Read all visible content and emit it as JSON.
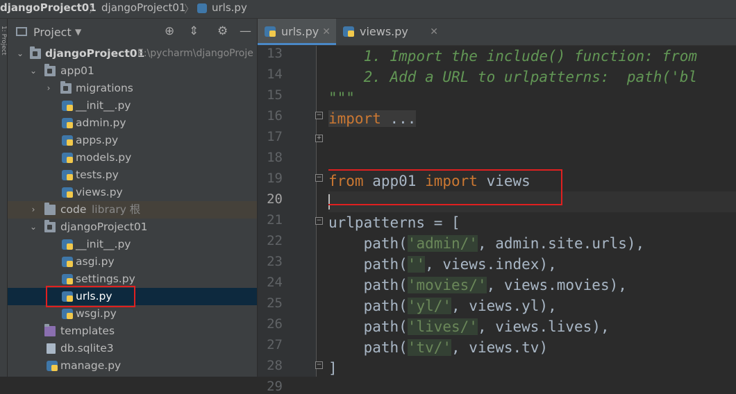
{
  "breadcrumbs": [
    "djangoProject01",
    "djangoProject01",
    "urls.py"
  ],
  "stripe_label": "1: Project",
  "project_panel": {
    "title": "Project",
    "icons": [
      "target-icon",
      "collapse-icon",
      "gear-icon",
      "minimize-icon"
    ]
  },
  "tree": [
    {
      "label": "djangoProject01",
      "extra": "E:\\pycharm\\djangoProje",
      "type": "folder-module",
      "bold": true,
      "expanded": true
    },
    {
      "label": "app01",
      "type": "folder-module",
      "expanded": true
    },
    {
      "label": "migrations",
      "type": "folder-module",
      "expanded": false
    },
    {
      "label": "__init__.py",
      "type": "py"
    },
    {
      "label": "admin.py",
      "type": "py"
    },
    {
      "label": "apps.py",
      "type": "py"
    },
    {
      "label": "models.py",
      "type": "py"
    },
    {
      "label": "tests.py",
      "type": "py"
    },
    {
      "label": "views.py",
      "type": "py"
    },
    {
      "label": "code",
      "extra": "library 根",
      "type": "folder",
      "expanded": false
    },
    {
      "label": "djangoProject01",
      "type": "folder-module",
      "expanded": true
    },
    {
      "label": "__init__.py",
      "type": "py"
    },
    {
      "label": "asgi.py",
      "type": "py"
    },
    {
      "label": "settings.py",
      "type": "py"
    },
    {
      "label": "urls.py",
      "type": "py",
      "selected": true
    },
    {
      "label": "wsgi.py",
      "type": "py"
    },
    {
      "label": "templates",
      "type": "folder"
    },
    {
      "label": "db.sqlite3",
      "type": "file"
    },
    {
      "label": "manage.py",
      "type": "py"
    }
  ],
  "tabs": [
    {
      "label": "urls.py",
      "active": true
    },
    {
      "label": "views.py",
      "active": false
    }
  ],
  "line_numbers": [
    "13",
    "14",
    "15",
    "16",
    "17",
    "18",
    "19",
    "20",
    "21",
    "22",
    "23",
    "24",
    "25",
    "26",
    "27",
    "28",
    "29"
  ],
  "current_line": "20",
  "code": {
    "l13": "    1. Import the include() function: from",
    "l14": "    2. Add a URL to urlpatterns:  path('bl",
    "l15": "\"\"\"",
    "l16_kw": "import",
    "l16_rest": " ...",
    "l19_from": "from",
    "l19_mod": " app01 ",
    "l19_import": "import",
    "l19_name": " views",
    "l21": "urlpatterns = [",
    "l22_pre": "    path(",
    "l22_str": "'admin/'",
    "l22_post": ", admin.site.urls),",
    "l23_pre": "    path(",
    "l23_str": "''",
    "l23_post": ", views.index),",
    "l24_pre": "    path(",
    "l24_str": "'movies/'",
    "l24_post": ", views.movies),",
    "l25_pre": "    path(",
    "l25_str": "'yl/'",
    "l25_post": ", views.yl),",
    "l26_pre": "    path(",
    "l26_str": "'lives/'",
    "l26_post": ", views.lives),",
    "l27_pre": "    path(",
    "l27_str": "'tv/'",
    "l27_post": ", views.tv)",
    "l28": "]"
  },
  "colors": {
    "keyword": "#cc7832",
    "string": "#6a8759",
    "comment": "#629755",
    "highlight_box": "#e02020"
  }
}
